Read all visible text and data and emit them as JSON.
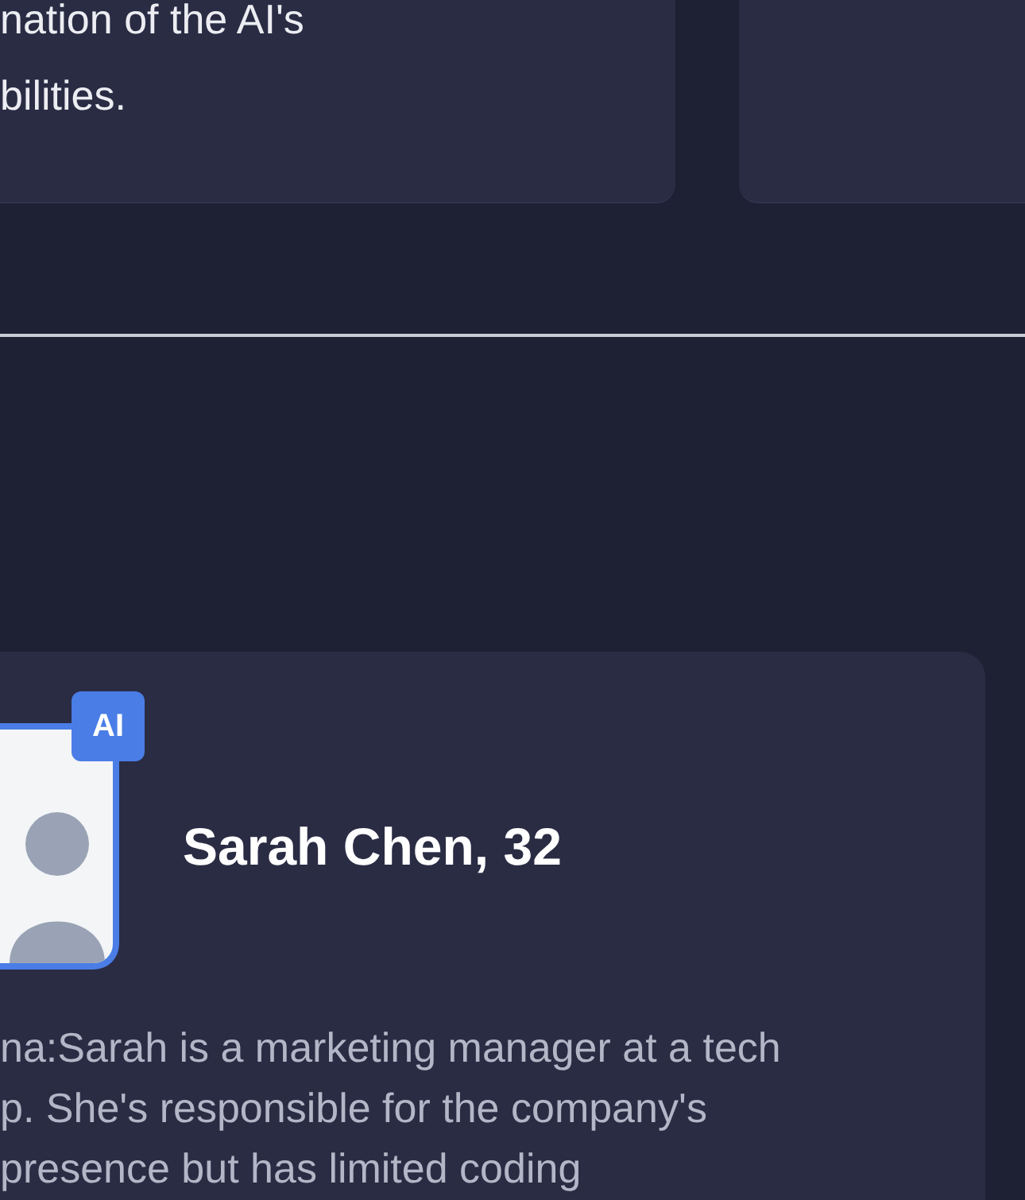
{
  "top_card": {
    "description_lines": [
      "nation of the AI's",
      "bilities."
    ]
  },
  "persona": {
    "badge": "AI",
    "name": "Sarah Chen, 32",
    "description_lines": [
      "na:Sarah is a marketing manager at a tech",
      "p. She's responsible for the company's",
      "presence but has limited coding"
    ]
  }
}
